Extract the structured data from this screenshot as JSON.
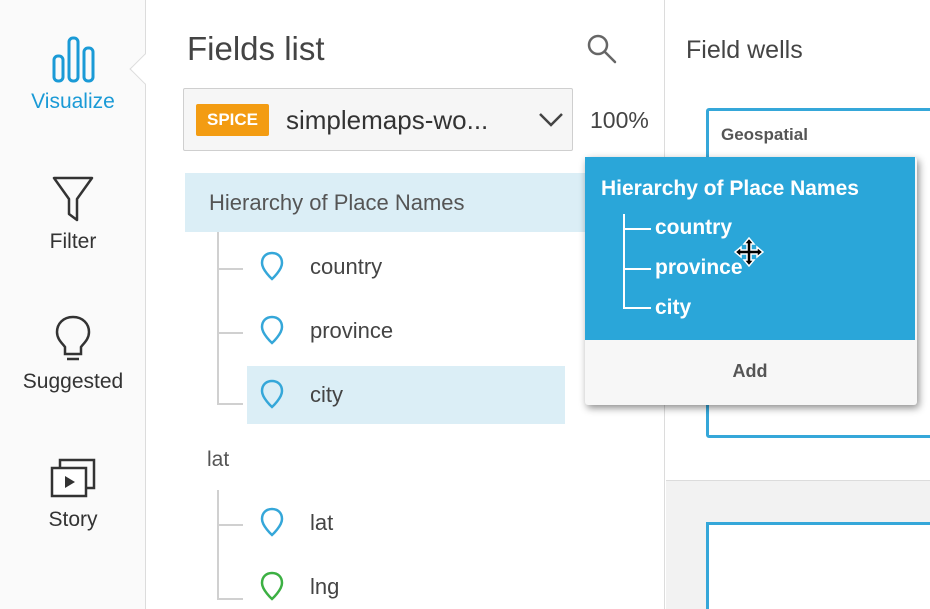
{
  "nav": {
    "visualize": "Visualize",
    "filter": "Filter",
    "suggested": "Suggested",
    "story": "Story"
  },
  "fields_panel": {
    "title": "Fields list",
    "dataset_badge": "SPICE",
    "dataset_name": "simplemaps-wo...",
    "spice_percent": "100%",
    "hierarchy_name": "Hierarchy of Place Names",
    "hierarchy_fields": [
      "country",
      "province",
      "city"
    ],
    "group_label": "lat",
    "group_fields": [
      "lat",
      "lng"
    ]
  },
  "field_wells": {
    "title": "Field wells",
    "geospatial_label": "Geospatial"
  },
  "drag_card": {
    "title": "Hierarchy of Place Names",
    "items": [
      "country",
      "province",
      "city"
    ],
    "add_label": "Add"
  },
  "colors": {
    "accent": "#2aa6d9",
    "selected_bg": "#dbeef6",
    "spice_badge": "#f39c12",
    "pin_blue": "#35a7d9",
    "pin_green": "#3cb043"
  }
}
